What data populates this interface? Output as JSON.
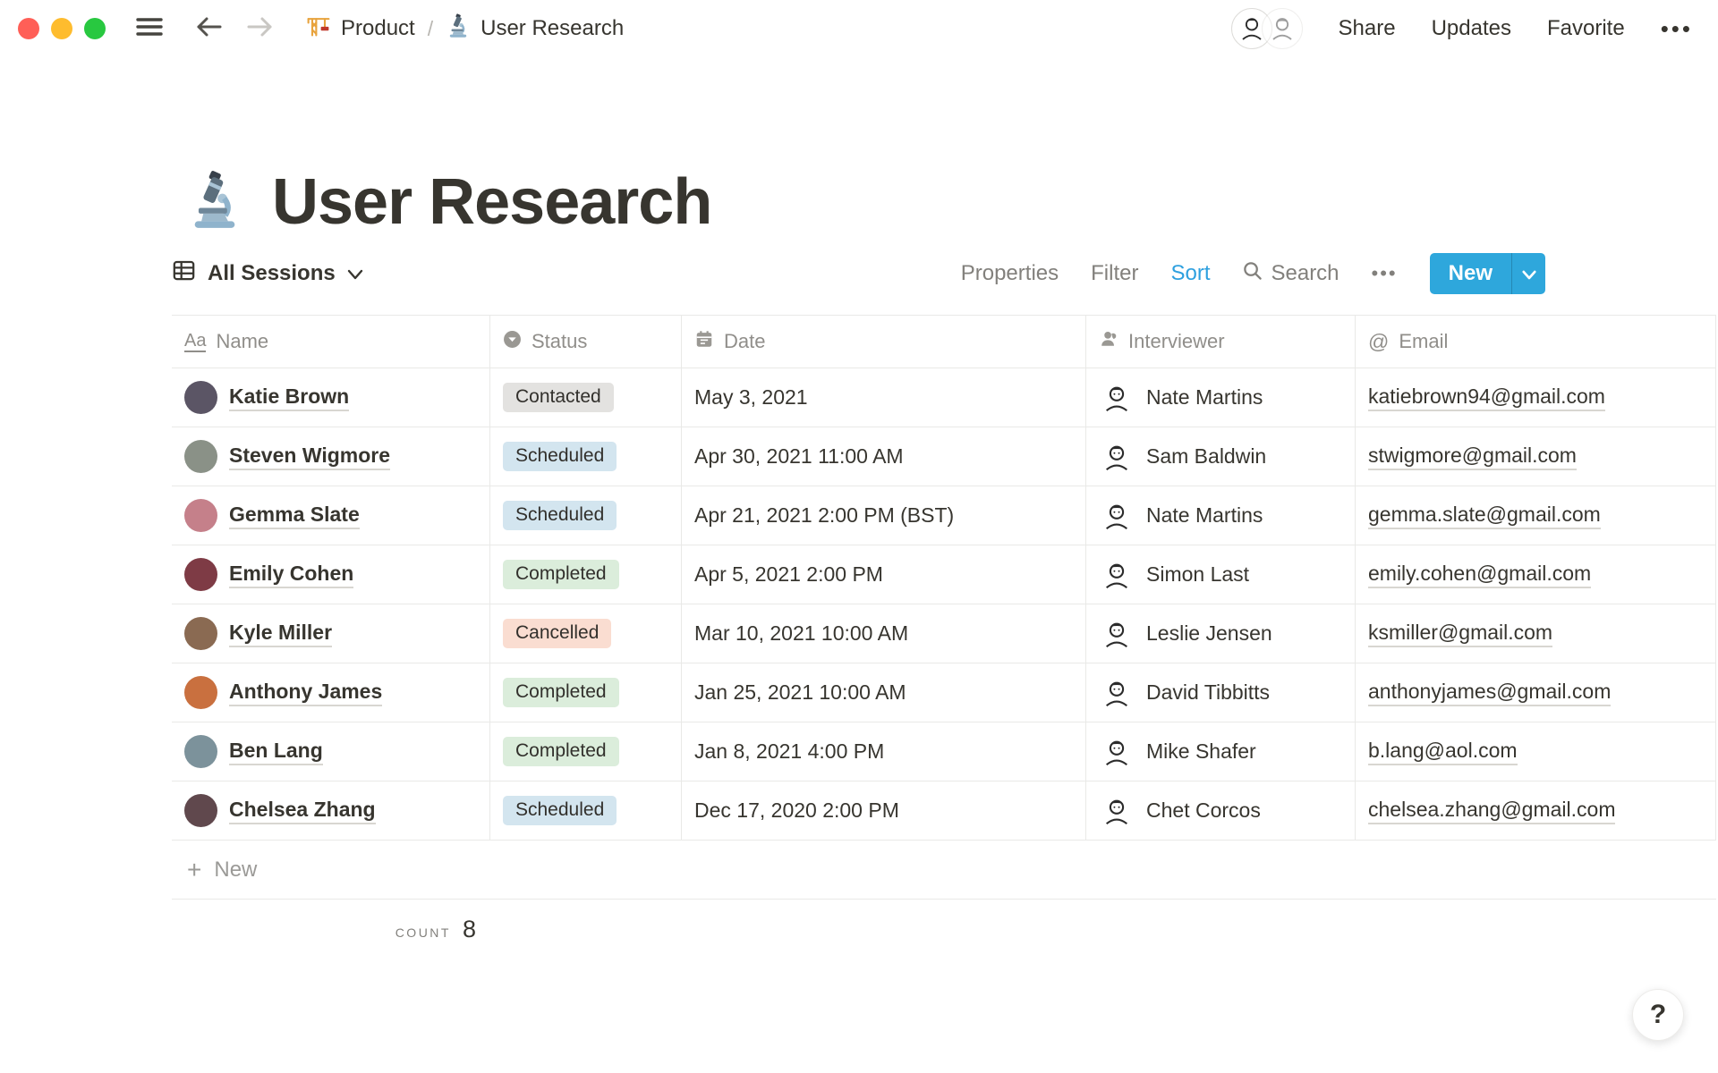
{
  "window_controls": {
    "close_color": "#FF5F57",
    "minimize_color": "#FEBC2E",
    "zoom_color": "#28C840"
  },
  "topbar": {
    "breadcrumb": {
      "items": [
        {
          "label": "Product"
        },
        {
          "label": "User Research"
        }
      ],
      "separator": "/"
    },
    "share_label": "Share",
    "updates_label": "Updates",
    "favorite_label": "Favorite",
    "more_label": "•••"
  },
  "page": {
    "title": "User Research"
  },
  "view_bar": {
    "view_label": "All Sessions",
    "properties_label": "Properties",
    "filter_label": "Filter",
    "sort_label": "Sort",
    "search_label": "Search",
    "more_label": "•••",
    "new_label": "New",
    "sort_color": "#2EA0DF",
    "new_bg": "#2EA7DC"
  },
  "table": {
    "columns": [
      {
        "label": "Name"
      },
      {
        "label": "Status"
      },
      {
        "label": "Date"
      },
      {
        "label": "Interviewer"
      },
      {
        "label": "Email"
      }
    ],
    "badge_colors": {
      "gray": "#E3E2E0",
      "blue": "#D3E5EF",
      "green": "#DBEDDB",
      "red": "#FADDD1"
    },
    "rows": [
      {
        "name": "Katie Brown",
        "avatar_color": "#5B5565",
        "status": "Contacted",
        "status_color": "gray",
        "date": "May 3, 2021",
        "interviewer": "Nate Martins",
        "email": "katiebrown94@gmail.com"
      },
      {
        "name": "Steven Wigmore",
        "avatar_color": "#8A9187",
        "status": "Scheduled",
        "status_color": "blue",
        "date": "Apr 30, 2021 11:00 AM",
        "interviewer": "Sam Baldwin",
        "email": "stwigmore@gmail.com"
      },
      {
        "name": "Gemma Slate",
        "avatar_color": "#C5808A",
        "status": "Scheduled",
        "status_color": "blue",
        "date": "Apr 21, 2021 2:00 PM (BST)",
        "interviewer": "Nate Martins",
        "email": "gemma.slate@gmail.com"
      },
      {
        "name": "Emily Cohen",
        "avatar_color": "#7E3B45",
        "status": "Completed",
        "status_color": "green",
        "date": "Apr 5, 2021 2:00 PM",
        "interviewer": "Simon Last",
        "email": "emily.cohen@gmail.com"
      },
      {
        "name": "Kyle Miller",
        "avatar_color": "#8A6A52",
        "status": "Cancelled",
        "status_color": "red",
        "date": "Mar 10, 2021 10:00 AM",
        "interviewer": "Leslie Jensen",
        "email": "ksmiller@gmail.com"
      },
      {
        "name": "Anthony James",
        "avatar_color": "#C9703F",
        "status": "Completed",
        "status_color": "green",
        "date": "Jan 25, 2021 10:00 AM",
        "interviewer": "David Tibbitts",
        "email": "anthonyjames@gmail.com"
      },
      {
        "name": "Ben Lang",
        "avatar_color": "#7C929B",
        "status": "Completed",
        "status_color": "green",
        "date": "Jan 8, 2021 4:00 PM",
        "interviewer": "Mike Shafer",
        "email": "b.lang@aol.com"
      },
      {
        "name": "Chelsea Zhang",
        "avatar_color": "#60484D",
        "status": "Scheduled",
        "status_color": "blue",
        "date": "Dec 17, 2020 2:00 PM",
        "interviewer": "Chet Corcos",
        "email": "chelsea.zhang@gmail.com"
      }
    ],
    "new_row_label": "New",
    "count": {
      "label": "COUNT",
      "value": "8"
    }
  },
  "help_label": "?"
}
